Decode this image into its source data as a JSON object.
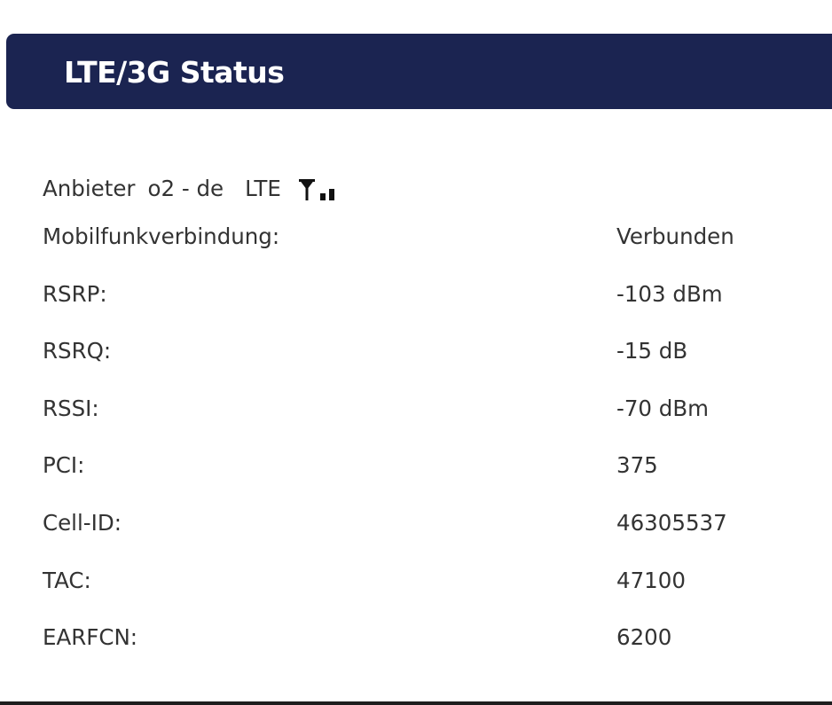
{
  "header": {
    "title": "LTE/3G Status"
  },
  "provider": {
    "label": "Anbieter",
    "name": "o2 - de",
    "technology": "LTE",
    "signal_icon": "signal-antenna-icon",
    "signal_bars_active": 2
  },
  "status": {
    "rows": [
      {
        "label": "Mobilfunkverbindung:",
        "value": "Verbunden"
      },
      {
        "label": "RSRP:",
        "value": "-103 dBm"
      },
      {
        "label": "RSRQ:",
        "value": "-15 dB"
      },
      {
        "label": "RSSI:",
        "value": "-70 dBm"
      },
      {
        "label": "PCI:",
        "value": "375"
      },
      {
        "label": "Cell-ID:",
        "value": "46305537"
      },
      {
        "label": "TAC:",
        "value": "47100"
      },
      {
        "label": "EARFCN:",
        "value": "6200"
      }
    ]
  },
  "colors": {
    "header_background": "#1b2451",
    "header_text": "#ffffff",
    "body_text": "#333333",
    "divider": "#1e1e1e"
  }
}
